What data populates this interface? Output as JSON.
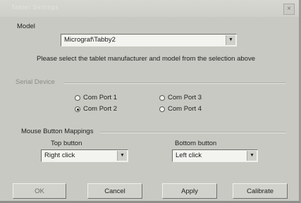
{
  "window": {
    "title": "Tablet Settings",
    "close_glyph": "×"
  },
  "model": {
    "label": "Model",
    "selected": "Micrograf\\Tabby2",
    "hint": "Please select the tablet manufacturer and model from the selection above"
  },
  "serial": {
    "label": "Serial Device",
    "ports": [
      {
        "label": "Com Port 1",
        "selected": false
      },
      {
        "label": "Com Port 3",
        "selected": false
      },
      {
        "label": "Com Port 2",
        "selected": true
      },
      {
        "label": "Com Port 4",
        "selected": false
      }
    ]
  },
  "mouse": {
    "label": "Mouse Button Mappings",
    "top_label": "Top button",
    "top_value": "Right click",
    "bottom_label": "Bottom button",
    "bottom_value": "Left click"
  },
  "buttons": {
    "ok": "OK",
    "cancel": "Cancel",
    "apply": "Apply",
    "calibrate": "Calibrate"
  },
  "icons": {
    "combo_arrow": "▼"
  }
}
